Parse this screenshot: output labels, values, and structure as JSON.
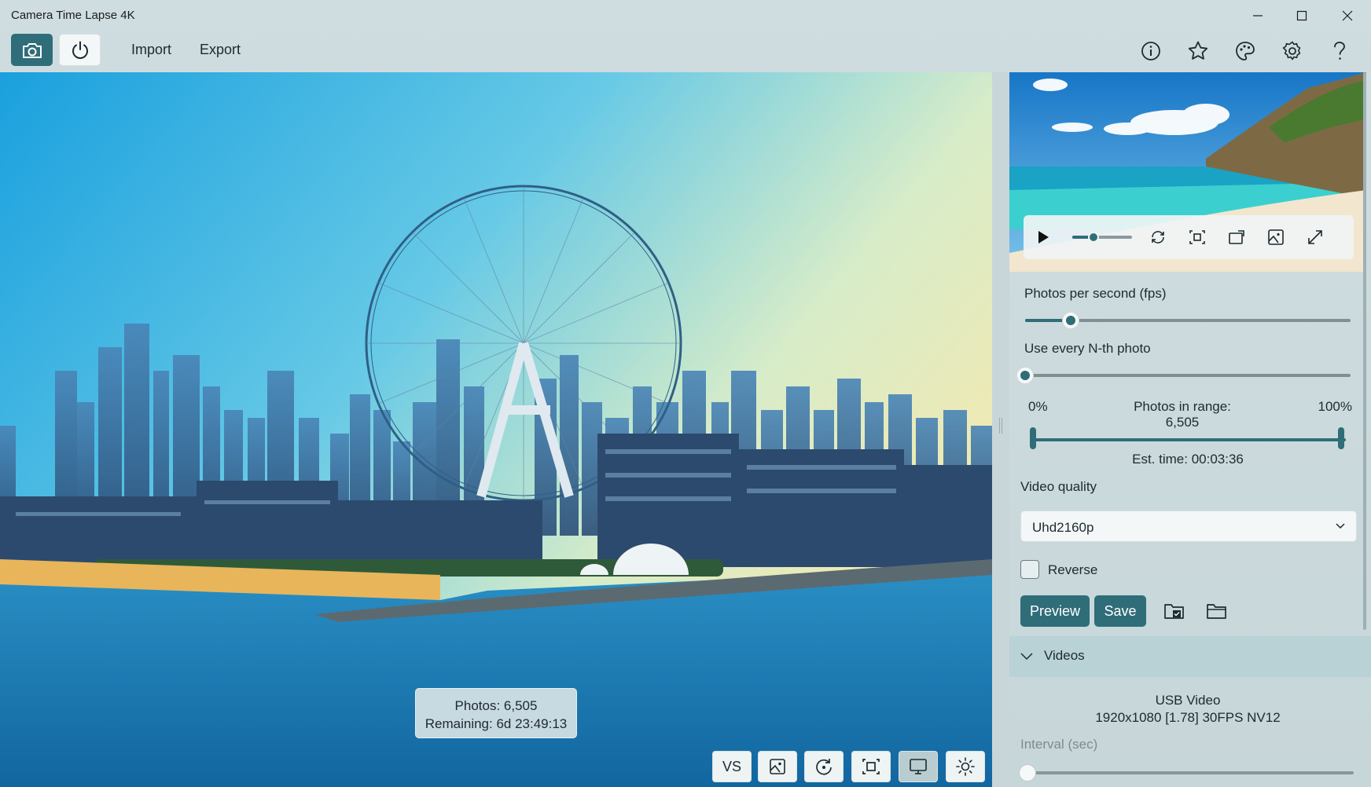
{
  "window": {
    "title": "Camera Time Lapse 4K"
  },
  "toolbar": {
    "import_label": "Import",
    "export_label": "Export"
  },
  "overlay": {
    "photos": "Photos: 6,505",
    "remaining": "Remaining: 6d 23:49:13"
  },
  "bottom_tools": {
    "vs_label": "VS"
  },
  "player": {
    "volume_level": 0.35
  },
  "panel": {
    "fps_label": "Photos per second (fps)",
    "fps_level": 0.14,
    "nth_label": "Use every N-th photo",
    "nth_level": 0.0,
    "range_min": "0%",
    "range_info": "Photos in range: 6,505",
    "range_max": "100%",
    "est_time": "Est. time: 00:03:36",
    "quality_label": "Video quality",
    "quality_value": "Uhd2160p",
    "reverse_label": "Reverse",
    "preview_button": "Preview",
    "save_button": "Save",
    "videos_section": "Videos",
    "device_name": "USB Video",
    "device_format": "1920x1080 [1.78] 30FPS NV12",
    "interval_label": "Interval (sec)"
  },
  "colors": {
    "accent": "#2f6d79",
    "panel": "#cfdde0"
  }
}
